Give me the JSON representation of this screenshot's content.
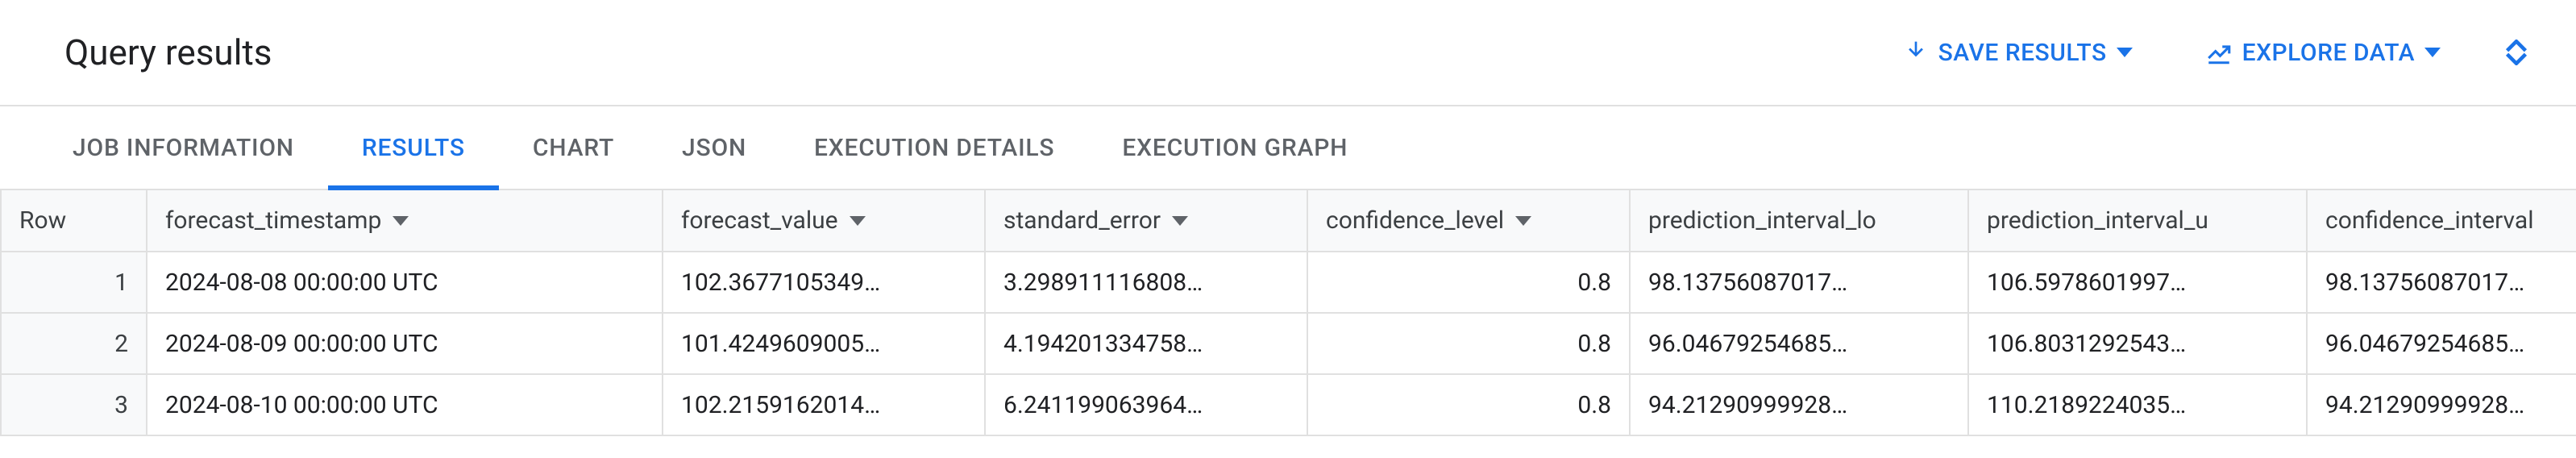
{
  "header": {
    "title": "Query results",
    "save_label": "SAVE RESULTS",
    "explore_label": "EXPLORE DATA"
  },
  "tabs": {
    "items": [
      {
        "label": "JOB INFORMATION",
        "active": false
      },
      {
        "label": "RESULTS",
        "active": true
      },
      {
        "label": "CHART",
        "active": false
      },
      {
        "label": "JSON",
        "active": false
      },
      {
        "label": "EXECUTION DETAILS",
        "active": false
      },
      {
        "label": "EXECUTION GRAPH",
        "active": false
      }
    ]
  },
  "table": {
    "columns": {
      "row": "Row",
      "forecast_timestamp": "forecast_timestamp",
      "forecast_value": "forecast_value",
      "standard_error": "standard_error",
      "confidence_level": "confidence_level",
      "prediction_interval_lower": "prediction_interval_lo",
      "prediction_interval_upper": "prediction_interval_u",
      "confidence_interval": "confidence_interval"
    },
    "rows": [
      {
        "row": "1",
        "forecast_timestamp": "2024-08-08 00:00:00 UTC",
        "forecast_value": "102.3677105349…",
        "standard_error": "3.298911116808…",
        "confidence_level": "0.8",
        "prediction_interval_lower": "98.13756087017…",
        "prediction_interval_upper": "106.5978601997…",
        "confidence_interval": "98.13756087017…"
      },
      {
        "row": "2",
        "forecast_timestamp": "2024-08-09 00:00:00 UTC",
        "forecast_value": "101.4249609005…",
        "standard_error": "4.194201334758…",
        "confidence_level": "0.8",
        "prediction_interval_lower": "96.04679254685…",
        "prediction_interval_upper": "106.8031292543…",
        "confidence_interval": "96.04679254685…"
      },
      {
        "row": "3",
        "forecast_timestamp": "2024-08-10 00:00:00 UTC",
        "forecast_value": "102.2159162014…",
        "standard_error": "6.241199063964…",
        "confidence_level": "0.8",
        "prediction_interval_lower": "94.21290999928…",
        "prediction_interval_upper": "110.2189224035…",
        "confidence_interval": "94.21290999928…"
      }
    ]
  }
}
